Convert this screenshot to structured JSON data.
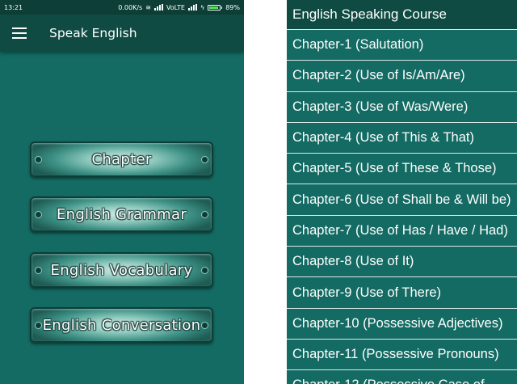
{
  "status_bar": {
    "time": "13:21",
    "speed": "0.00K/s",
    "network": "VoLTE",
    "battery": "89%",
    "battery_level": 0.89
  },
  "app_bar": {
    "title": "Speak English",
    "menu_icon": "hamburger-menu-icon"
  },
  "menu_buttons": [
    {
      "label": "Chapter"
    },
    {
      "label": "English Grammar"
    },
    {
      "label": "English Vocabulary"
    },
    {
      "label": "English Conversation"
    }
  ],
  "drawer": {
    "header": "English Speaking Course",
    "items": [
      {
        "label": "Chapter-1 (Salutation)"
      },
      {
        "label": "Chapter-2 (Use of Is/Am/Are)"
      },
      {
        "label": "Chapter-3 (Use of Was/Were)"
      },
      {
        "label": "Chapter-4 (Use of This & That)"
      },
      {
        "label": "Chapter-5 (Use of These & Those)"
      },
      {
        "label": "Chapter-6 (Use of Shall be & Will be)"
      },
      {
        "label": "Chapter-7 (Use of Has / Have / Had)"
      },
      {
        "label": "Chapter-8 (Use of It)"
      },
      {
        "label": "Chapter-9 (Use of There)"
      },
      {
        "label": "Chapter-10 (Possessive Adjectives)"
      },
      {
        "label": "Chapter-11 (Possessive Pronouns)"
      },
      {
        "label": "Chapter-12 (Possessive Case of..."
      }
    ]
  },
  "colors": {
    "background": "#136b63",
    "app_bar": "#0f4b43",
    "status_bar": "#0e3f37",
    "divider": "#dfe9e7"
  }
}
